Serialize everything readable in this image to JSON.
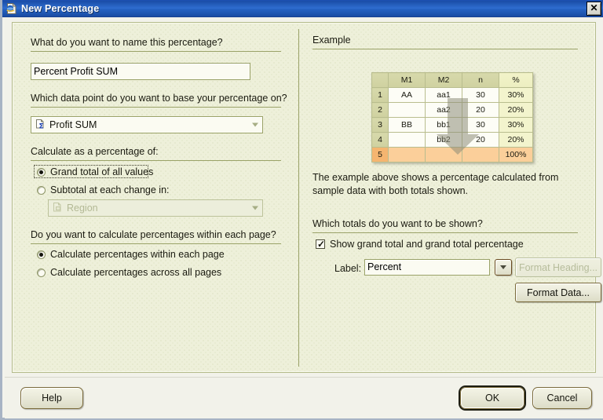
{
  "window": {
    "title": "New Percentage",
    "icon": "page-sigma-icon",
    "close_label": "✕"
  },
  "left": {
    "name_question": {
      "pre": "What do you w",
      "accel": "a",
      "mid": "nt to name this percenta",
      "accel2": "g",
      "post": "e?"
    },
    "name_question_text": "What do you want to name this percentage?",
    "name_value": "Percent Profit SUM",
    "datapoint_question": "Which data point do you want to base your percentage on?",
    "datapoint_value": "Profit SUM",
    "datapoint_icon": "data-point-sigma-icon",
    "calc_as_label": "Calculate as a percentage of:",
    "radio_grand_total": "Grand total of all values",
    "radio_subtotal": "Subtotal at each change in:",
    "subtotal_value": "Region",
    "subtotal_icon": "region-item-icon",
    "page_question": "Do you want to calculate percentages within each page?",
    "radio_within_page": "Calculate percentages within each page",
    "radio_across_pages": "Calculate percentages across all pages",
    "selected_calc_as": "grand_total",
    "selected_page_scope": "within_page"
  },
  "right": {
    "example_heading": "Example",
    "description_line1": "The example above shows a percentage calculated from",
    "description_line2": "sample data with both totals shown.",
    "totals_question": "Which totals do you want to be shown?",
    "show_grand_total_label": "Show grand total and grand total percentage",
    "show_grand_total_checked": true,
    "label_caption": "Label:",
    "label_value": "Percent",
    "format_heading_button": "Format Heading...",
    "format_heading_disabled": true,
    "format_data_button": "Format Data..."
  },
  "example_table": {
    "columns": [
      "",
      "M1",
      "M2",
      "n",
      "%"
    ],
    "rows": [
      {
        "num": "1",
        "cells": [
          "AA",
          "aa1",
          "30",
          "30%"
        ]
      },
      {
        "num": "2",
        "cells": [
          "",
          "aa2",
          "20",
          "20%"
        ]
      },
      {
        "num": "3",
        "cells": [
          "BB",
          "bb1",
          "30",
          "30%"
        ]
      },
      {
        "num": "4",
        "cells": [
          "",
          "bb2",
          "20",
          "20%"
        ]
      },
      {
        "num": "5",
        "cells": [
          "",
          "",
          "",
          "100%"
        ],
        "total": true
      }
    ]
  },
  "buttons": {
    "help": "Help",
    "ok": "OK",
    "cancel": "Cancel"
  },
  "colors": {
    "title_bar": "#1c50b4",
    "panel_bg": "#eef0da",
    "rule": "#9aa268",
    "total_row": "#fbcf9a",
    "pct_col": "#f3f4cd",
    "header_cell": "#d1d3a2"
  }
}
